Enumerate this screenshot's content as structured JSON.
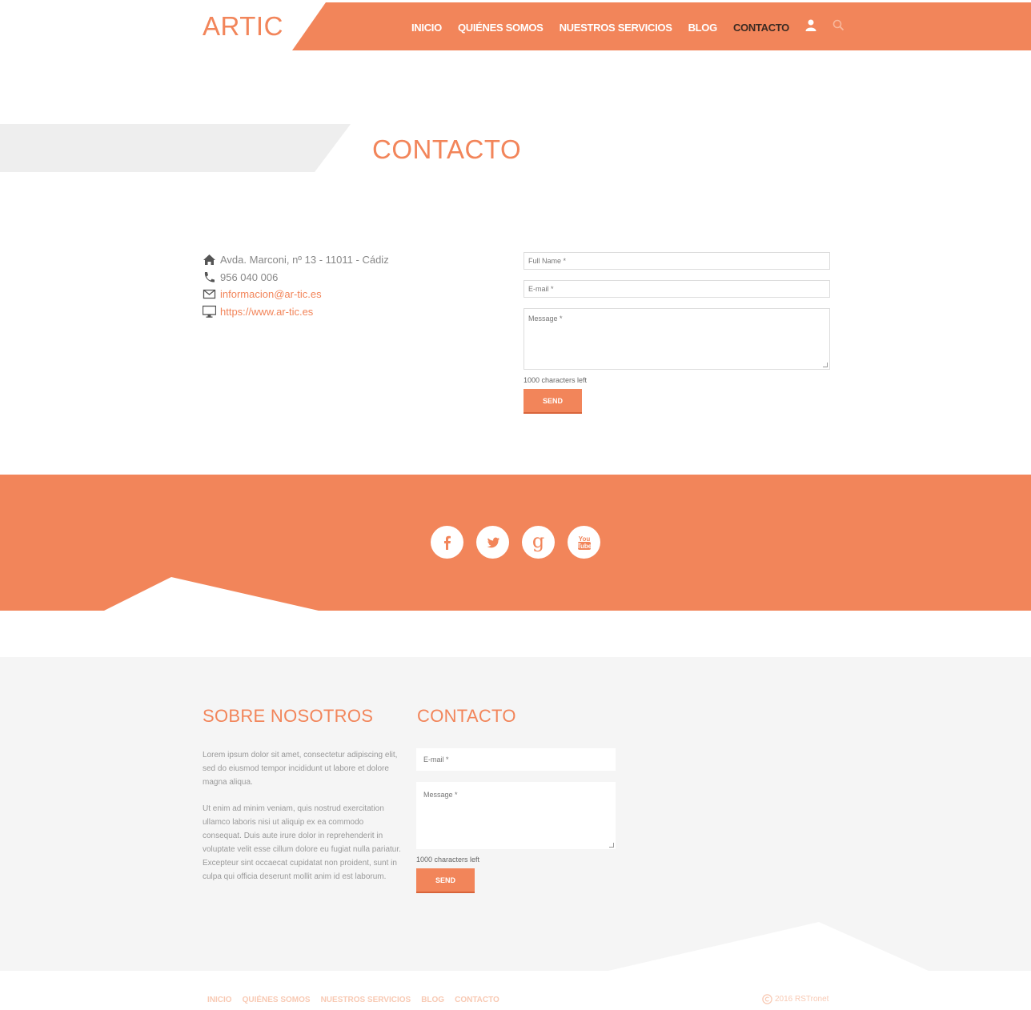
{
  "header": {
    "logo": "ARTIC",
    "nav": [
      "INICIO",
      "QUIÉNES SOMOS",
      "NUESTROS SERVICIOS",
      "BLOG",
      "CONTACTO"
    ],
    "active": "CONTACTO"
  },
  "page": {
    "title": "CONTACTO"
  },
  "contact_info": {
    "address": "Avda. Marconi, nº 13 - 11011 - Cádiz",
    "phone": "956 040 006",
    "email": "informacion@ar-tic.es",
    "website": "https://www.ar-tic.es"
  },
  "form": {
    "full_name_placeholder": "Full Name *",
    "email_placeholder": "E-mail *",
    "message_placeholder": "Message *",
    "chars_left": "1000 characters left",
    "send_label": "SEND"
  },
  "social": [
    "facebook-icon",
    "twitter-icon",
    "google-plus-icon",
    "youtube-icon"
  ],
  "footer": {
    "about_title": "SOBRE NOSOTROS",
    "about_p1": "Lorem ipsum dolor sit amet, consectetur adipiscing elit, sed do eiusmod tempor incididunt ut labore et dolore magna aliqua.",
    "about_p2": "Ut enim ad minim veniam, quis nostrud exercitation ullamco laboris nisi ut aliquip ex ea commodo consequat. Duis aute irure dolor in reprehenderit in voluptate velit esse cillum dolore eu fugiat nulla pariatur. Excepteur sint occaecat cupidatat non proident, sunt in culpa qui officia deserunt mollit anim id est laborum.",
    "contact_title": "CONTACTO",
    "email_placeholder": "E-mail *",
    "message_placeholder": "Message *",
    "chars_left": "1000 characters left",
    "send_label": "SEND",
    "bottom_nav": [
      "INICIO",
      "QUIÉNES SOMOS",
      "NUESTROS SERVICIOS",
      "BLOG",
      "CONTACTO"
    ],
    "copyright": "2016 RSTronet"
  },
  "colors": {
    "accent": "#f2855a",
    "gray_bg": "#f5f5f5"
  }
}
